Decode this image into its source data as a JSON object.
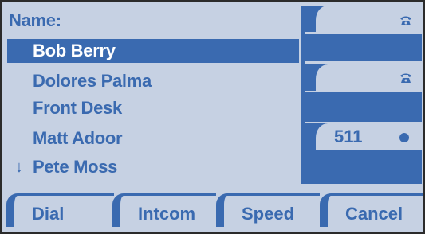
{
  "list": {
    "header": "Name:",
    "items": [
      {
        "label": "Bob Berry",
        "selected": true
      },
      {
        "label": "Dolores Palma",
        "selected": false
      },
      {
        "label": "Front Desk",
        "selected": false
      },
      {
        "label": "Matt Adoor",
        "selected": false
      },
      {
        "label": "Pete Moss",
        "selected": false,
        "more_indicator": "↓"
      }
    ]
  },
  "lines": [
    {
      "icon": "phone-icon",
      "label": ""
    },
    {
      "icon": "phone-icon",
      "label": ""
    },
    {
      "icon": "dot-icon",
      "label": "511"
    }
  ],
  "softkeys": [
    "Dial",
    "Intcom",
    "Speed",
    "Cancel"
  ],
  "colors": {
    "accent": "#3a6ab0",
    "background": "#c6d1e3"
  }
}
